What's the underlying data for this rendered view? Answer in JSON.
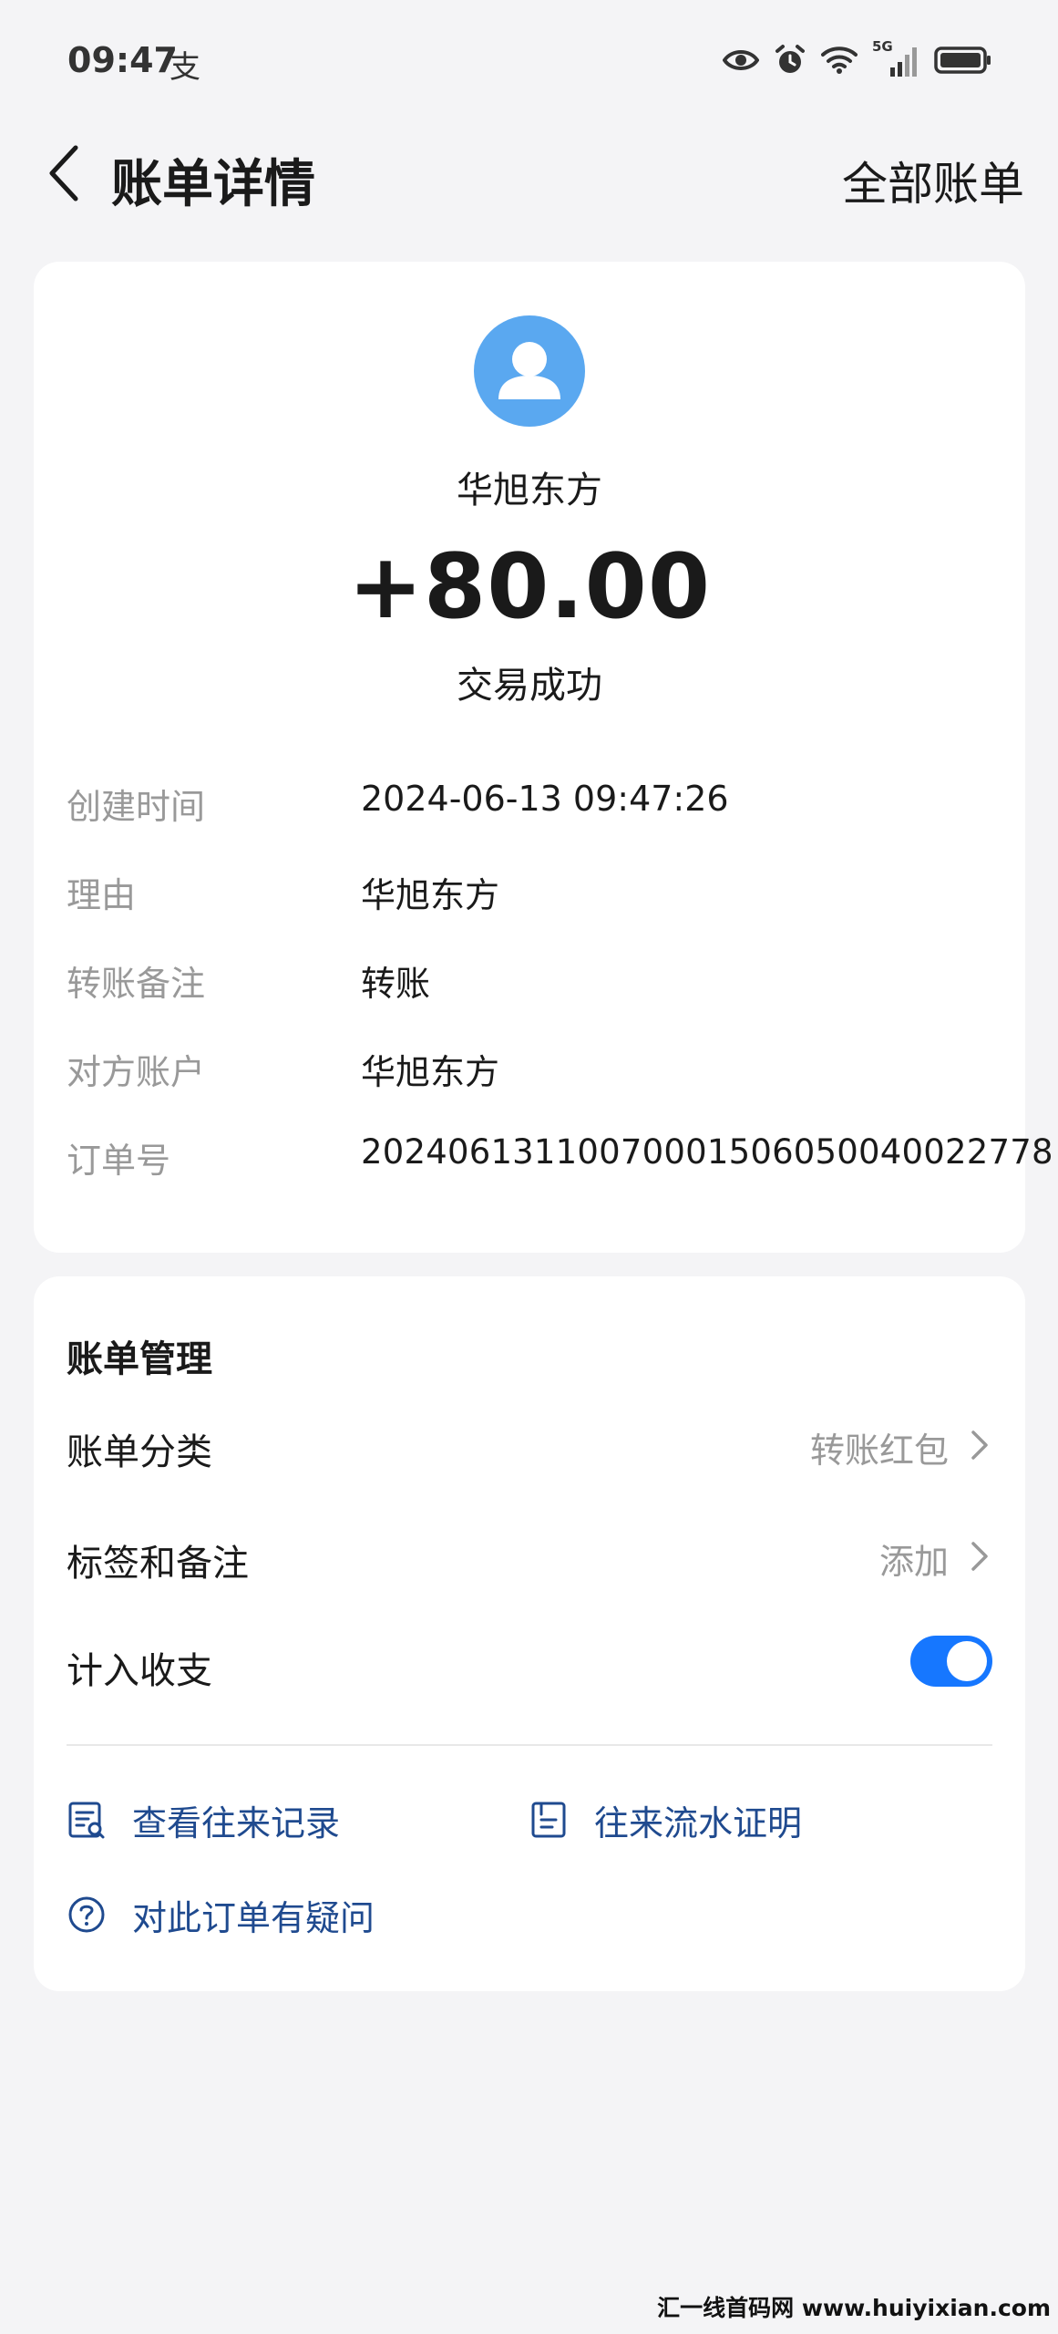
{
  "status_bar": {
    "time": "09:47",
    "app_indicator": "支",
    "icons": [
      "eye-icon",
      "alarm-icon",
      "wifi-icon",
      "cellular-5g-icon",
      "battery-icon"
    ],
    "network_label": "5G"
  },
  "header": {
    "back_icon": "chevron-left-icon",
    "title": "账单详情",
    "all_bills_label": "全部账单"
  },
  "transaction": {
    "avatar_icon": "user-avatar-icon",
    "payer_name": "华旭东方",
    "amount": "+80.00",
    "status": "交易成功",
    "details": [
      {
        "label": "创建时间",
        "value": "2024-06-13 09:47:26"
      },
      {
        "label": "理由",
        "value": "华旭东方"
      },
      {
        "label": "转账备注",
        "value": "转账"
      },
      {
        "label": "对方账户",
        "value": "华旭东方"
      },
      {
        "label": "订单号",
        "value": "20240613110070001506050040022778"
      }
    ]
  },
  "management": {
    "title": "账单管理",
    "category": {
      "label": "账单分类",
      "value": "转账红包"
    },
    "tags": {
      "label": "标签和备注",
      "value": "添加"
    },
    "include_in_budget": {
      "label": "计入收支",
      "enabled": true
    },
    "links": {
      "view_records": "查看往来记录",
      "statement_proof": "往来流水证明",
      "order_question": "对此订单有疑问"
    }
  },
  "colors": {
    "background": "#f4f4f6",
    "card": "#ffffff",
    "avatar": "#5aa8f0",
    "toggle_on": "#1677ff",
    "link": "#1f4a8f",
    "label_gray": "#999999"
  },
  "watermark": "汇一线首码网 www.huiyixian.com"
}
